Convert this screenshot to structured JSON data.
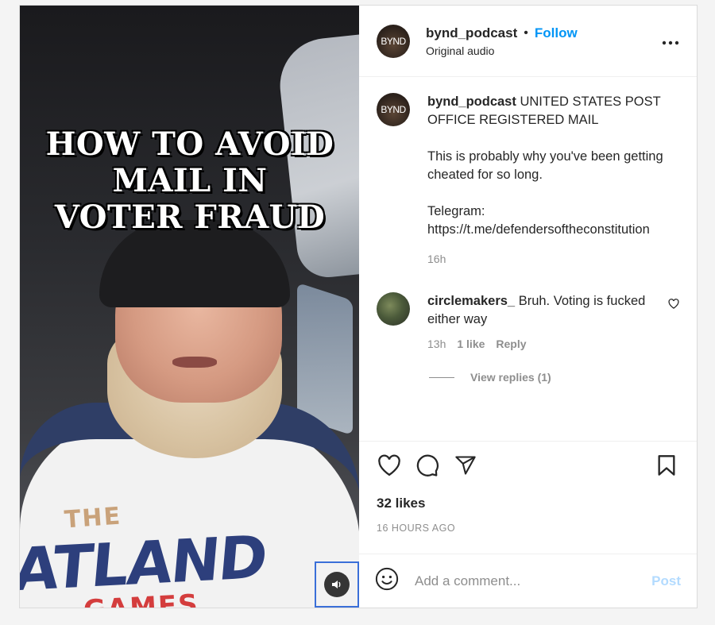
{
  "media": {
    "overlay_lines": [
      "HOW TO AVOID",
      "MAIL IN",
      "VOTER FRAUD"
    ],
    "shirt_text_small": "THE",
    "shirt_text_big": "ATLAND",
    "shirt_text_red": "GAMES",
    "sound_icon": "speaker-icon"
  },
  "header": {
    "avatar_text": "BYND",
    "username": "bynd_podcast",
    "separator": "•",
    "follow_label": "Follow",
    "subtitle": "Original audio",
    "more_icon": "more-options-icon"
  },
  "caption": {
    "avatar_text": "BYND",
    "username": "bynd_podcast",
    "line1": "UNITED STATES POST OFFICE REGISTERED MAIL",
    "line2": "This is probably why you've been getting cheated for so long.",
    "line3": "Telegram:",
    "line4": "https://t.me/defendersoftheconstitution",
    "time": "16h"
  },
  "comment": {
    "username": "circlemakers_",
    "text": "Bruh. Voting is fucked either way",
    "time": "13h",
    "likes": "1 like",
    "reply_label": "Reply",
    "view_replies": "View replies (1)"
  },
  "actions": {
    "likes": "32 likes",
    "ago": "16 HOURS AGO"
  },
  "add_comment": {
    "placeholder": "Add a comment...",
    "post_label": "Post"
  },
  "colors": {
    "accent": "#0095f6",
    "post_disabled": "#b3dbff",
    "muted": "#8e8e8e"
  }
}
